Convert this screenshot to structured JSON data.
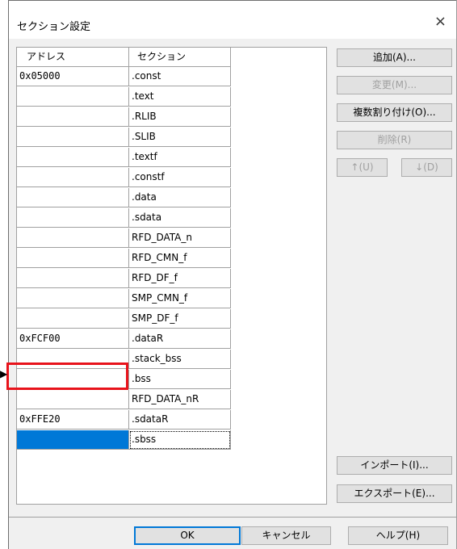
{
  "dialog": {
    "title": "セクション設定",
    "close_glyph": "×"
  },
  "table": {
    "columns": [
      "アドレス",
      "セクション"
    ],
    "rows": [
      {
        "address": "0x05000",
        "section": ".const"
      },
      {
        "address": "",
        "section": ".text"
      },
      {
        "address": "",
        "section": ".RLIB"
      },
      {
        "address": "",
        "section": ".SLIB"
      },
      {
        "address": "",
        "section": ".textf"
      },
      {
        "address": "",
        "section": ".constf"
      },
      {
        "address": "",
        "section": ".data"
      },
      {
        "address": "",
        "section": ".sdata"
      },
      {
        "address": "",
        "section": "RFD_DATA_n"
      },
      {
        "address": "",
        "section": "RFD_CMN_f"
      },
      {
        "address": "",
        "section": "RFD_DF_f"
      },
      {
        "address": "",
        "section": "SMP_CMN_f"
      },
      {
        "address": "",
        "section": "SMP_DF_f"
      },
      {
        "address": "0xFCF00",
        "section": ".dataR"
      },
      {
        "address": "",
        "section": ".stack_bss"
      },
      {
        "address": "",
        "section": ".bss"
      },
      {
        "address": "",
        "section": "RFD_DATA_nR"
      },
      {
        "address": "0xFFE20",
        "section": ".sdataR"
      },
      {
        "address": "",
        "section": ".sbss"
      }
    ]
  },
  "side_buttons": {
    "add": "追加(A)...",
    "change": "変更(M)...",
    "multi_assign": "複数割り付け(O)...",
    "delete": "削除(R)",
    "up": "↑(U)",
    "down": "↓(D)",
    "import": "インポート(I)...",
    "export": "エクスポート(E)..."
  },
  "bottom_buttons": {
    "ok": "OK",
    "cancel": "キャンセル",
    "help": "ヘルプ(H)"
  },
  "colors": {
    "selection": "#0078d7",
    "highlight_box": "#e8131b"
  }
}
